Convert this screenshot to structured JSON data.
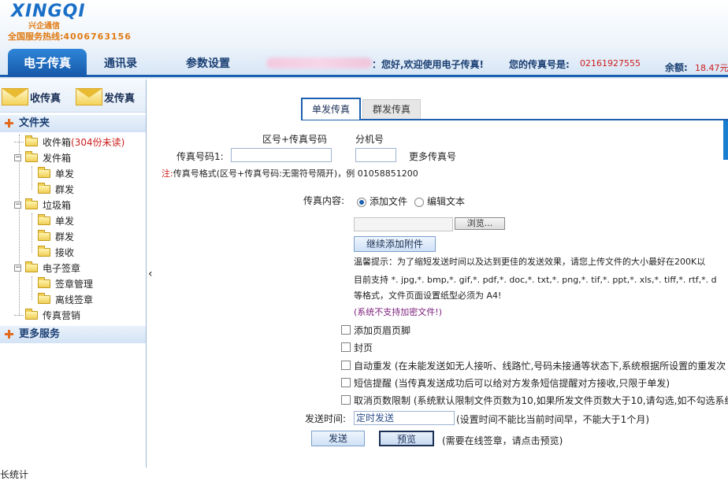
{
  "header": {
    "logo_text": "XINGQI",
    "logo_cn": "兴企通信",
    "hotline_label": "全国服务热线:",
    "hotline": "4006763156",
    "tabs": [
      "电子传真",
      "通讯录",
      "参数设置"
    ],
    "welcome": "：您好,欢迎使用电子传真!",
    "fax_number_label": "您的传真号是:",
    "fax_number": "02161927555",
    "balance_label": "余额:",
    "balance": "18.47元"
  },
  "sidebar": {
    "receive_button": "收传真",
    "send_button": "发传真",
    "folder_section": "文件夹",
    "tree": {
      "inbox": "收件箱",
      "inbox_unread": "(304份未读)",
      "outbox": "发件箱",
      "outbox_single": "单发",
      "outbox_group": "群发",
      "trash": "垃圾箱",
      "trash_single": "单发",
      "trash_group": "群发",
      "trash_receive": "接收",
      "esign": "电子签章",
      "sign_manage": "签章管理",
      "offline_sign": "离线签章",
      "fax_marketing": "传真营销"
    },
    "more_services": "更多服务",
    "collapse_arrow": "‹"
  },
  "content": {
    "tabs": [
      "单发传真",
      "群发传真"
    ],
    "area_code_label": "区号+传真号码",
    "ext_label": "分机号",
    "fax_number_field_label": "传真号码1:",
    "fax_number_value": "",
    "ext_value": "",
    "more_numbers": "更多传真号",
    "note_prefix": "注:",
    "note": "传真号格式(区号+传真号码:无需符号隔开)，例 01058851200",
    "fax_content_label": "传真内容:",
    "radio_add_file": "添加文件",
    "radio_edit_text": "编辑文本",
    "browse_button": "浏览...",
    "add_attachment_button": "继续添加附件",
    "tip_line1": "温馨提示：为了缩短发送时间以及达到更佳的发送效果，请您上传文件的大小最好在200K以",
    "tip_line2": "目前支持 *. jpg,*. bmp,*. gif,*. pdf,*. doc,*. txt,*. png,*. tif,*. ppt,*. xls,*. tiff,*. rtf,*. d",
    "tip_line3": "等格式，文件页面设置纸型必须为 A4!",
    "tip_line4": "(系统不支持加密文件!)",
    "options": [
      "添加页眉页脚",
      "封页",
      "自动重发 (在未能发送如无人接听、线路忙,号码未接通等状态下,系统根据所设置的重发次",
      "短信提醒 (当传真发送成功后可以给对方发条短信提醒对方接收,只限于单发)",
      "取消页数限制 (系统默认限制文件页数为10,如果所发文件页数大于10,请勾选,如不勾选系统"
    ],
    "send_time_label": "发送时间:",
    "send_time_value": "定时发送",
    "send_time_note": "(设置时间不能比当前时间早，不能大于1个月)",
    "send_button": "发送",
    "preview_button": "预览",
    "preview_note": "(需要在线签章，请点击预览)"
  },
  "footer": {
    "cut_text": "长统计"
  }
}
